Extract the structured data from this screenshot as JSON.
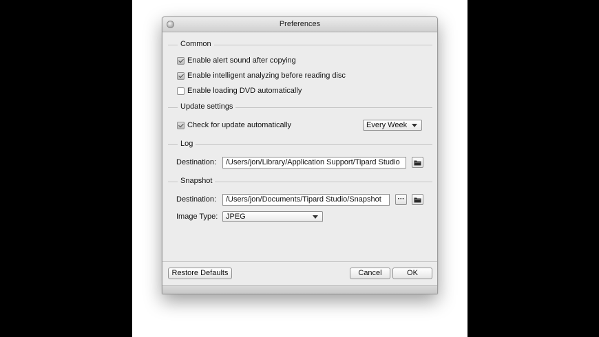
{
  "window": {
    "title": "Preferences"
  },
  "common": {
    "heading": "Common",
    "alert_sound": {
      "label": "Enable alert sound after copying",
      "checked": true
    },
    "intelligent": {
      "label": "Enable intelligent analyzing before reading disc",
      "checked": true
    },
    "loading_dvd": {
      "label": "Enable loading DVD automatically",
      "checked": false
    }
  },
  "update": {
    "heading": "Update settings",
    "check_update": {
      "label": "Check for update automatically",
      "checked": true
    },
    "frequency": "Every Week"
  },
  "log": {
    "heading": "Log",
    "destination_label": "Destination:",
    "destination_value": "/Users/jon/Library/Application Support/Tipard Studio"
  },
  "snapshot": {
    "heading": "Snapshot",
    "destination_label": "Destination:",
    "destination_value": "/Users/jon/Documents/Tipard Studio/Snapshot",
    "browse_more": "···",
    "image_type_label": "Image Type:",
    "image_type": "JPEG"
  },
  "buttons": {
    "restore_defaults": "Restore Defaults",
    "cancel": "Cancel",
    "ok": "OK"
  },
  "icons": {
    "close": "window-button-icon",
    "folder": "folder-icon"
  }
}
